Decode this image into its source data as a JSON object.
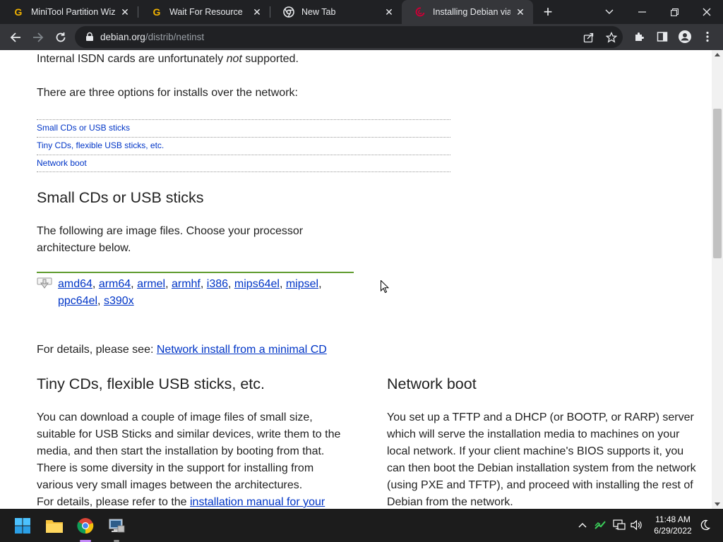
{
  "browser": {
    "tabs": [
      {
        "title": "MiniTool Partition Wiza",
        "icon": "g-favicon"
      },
      {
        "title": "Wait For Resource",
        "icon": "g-favicon"
      },
      {
        "title": "New Tab",
        "icon": "chrome-favicon"
      },
      {
        "title": "Installing Debian via th",
        "icon": "debian-favicon",
        "active": true
      }
    ],
    "url_host": "debian.org",
    "url_path": "/distrib/netinst"
  },
  "page": {
    "isdn_text_before": "Internal ISDN cards are unfortunately ",
    "isdn_text_em": "not",
    "isdn_text_after": " supported.",
    "options_intro": "There are three options for installs over the network:",
    "toc": [
      "Small CDs or USB sticks",
      "Tiny CDs, flexible USB sticks, etc.",
      "Network boot"
    ],
    "small_heading": "Small CDs or USB sticks",
    "small_intro_1": "The following are image files. Choose your processor",
    "small_intro_2": "architecture below.",
    "archs": [
      "amd64",
      "arm64",
      "armel",
      "armhf",
      "i386",
      "mips64el",
      "mipsel",
      "ppc64el",
      "s390x"
    ],
    "details_prefix": "For details, please see: ",
    "details_link": "Network install from a minimal CD",
    "tiny_heading": "Tiny CDs, flexible USB sticks, etc.",
    "tiny_lines": [
      "You can download a couple of image files of small size,",
      "suitable for USB Sticks and similar devices, write them to the",
      "media, and then start the installation by booting from that.",
      "There is some diversity in the support for installing from",
      "various very small images between the architectures."
    ],
    "tiny_details_prefix": "For details, please refer to the ",
    "tiny_details_link": "installation manual for your",
    "netboot_heading": "Network boot",
    "netboot_lines": [
      "You set up a TFTP and a DHCP (or BOOTP, or RARP) server",
      "which will serve the installation media to machines on your",
      "local network. If your client machine's BIOS supports it, you",
      "can then boot the Debian installation system from the network",
      "(using PXE and TFTP), and proceed with installing the rest of",
      "Debian from the network."
    ]
  },
  "taskbar": {
    "time": "11:48 AM",
    "date": "6/29/2022"
  },
  "colors": {
    "link": "#0035c7",
    "arch_rule": "#5f9c2e",
    "tab_strip": "#202124",
    "toolbar": "#35363a"
  }
}
